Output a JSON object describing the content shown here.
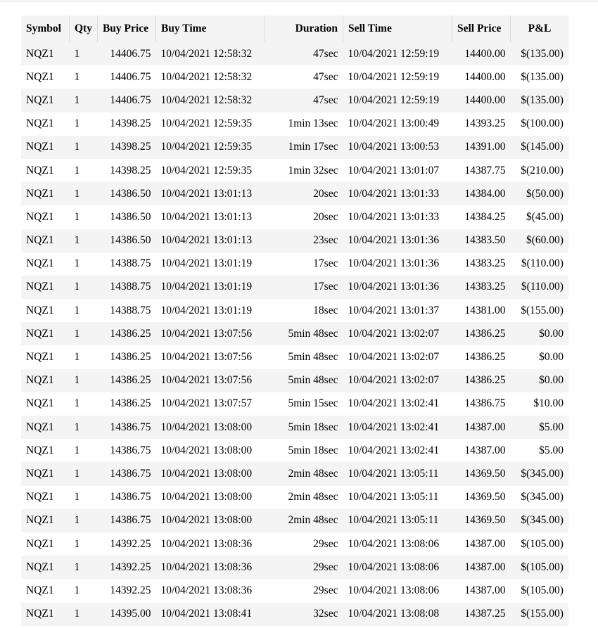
{
  "columns": {
    "symbol": "Symbol",
    "qty": "Qty",
    "buy_price": "Buy Price",
    "buy_time": "Buy Time",
    "duration": "Duration",
    "sell_time": "Sell Time",
    "sell_price": "Sell Price",
    "pnl": "P&L"
  },
  "rows": [
    {
      "symbol": "NQZ1",
      "qty": "1",
      "buy_price": "14406.75",
      "buy_time": "10/04/2021 12:58:32",
      "duration": "47sec",
      "sell_time": "10/04/2021 12:59:19",
      "sell_price": "14400.00",
      "pnl": "$(135.00)"
    },
    {
      "symbol": "NQZ1",
      "qty": "1",
      "buy_price": "14406.75",
      "buy_time": "10/04/2021 12:58:32",
      "duration": "47sec",
      "sell_time": "10/04/2021 12:59:19",
      "sell_price": "14400.00",
      "pnl": "$(135.00)"
    },
    {
      "symbol": "NQZ1",
      "qty": "1",
      "buy_price": "14406.75",
      "buy_time": "10/04/2021 12:58:32",
      "duration": "47sec",
      "sell_time": "10/04/2021 12:59:19",
      "sell_price": "14400.00",
      "pnl": "$(135.00)"
    },
    {
      "symbol": "NQZ1",
      "qty": "1",
      "buy_price": "14398.25",
      "buy_time": "10/04/2021 12:59:35",
      "duration": "1min 13sec",
      "sell_time": "10/04/2021 13:00:49",
      "sell_price": "14393.25",
      "pnl": "$(100.00)"
    },
    {
      "symbol": "NQZ1",
      "qty": "1",
      "buy_price": "14398.25",
      "buy_time": "10/04/2021 12:59:35",
      "duration": "1min 17sec",
      "sell_time": "10/04/2021 13:00:53",
      "sell_price": "14391.00",
      "pnl": "$(145.00)"
    },
    {
      "symbol": "NQZ1",
      "qty": "1",
      "buy_price": "14398.25",
      "buy_time": "10/04/2021 12:59:35",
      "duration": "1min 32sec",
      "sell_time": "10/04/2021 13:01:07",
      "sell_price": "14387.75",
      "pnl": "$(210.00)"
    },
    {
      "symbol": "NQZ1",
      "qty": "1",
      "buy_price": "14386.50",
      "buy_time": "10/04/2021 13:01:13",
      "duration": "20sec",
      "sell_time": "10/04/2021 13:01:33",
      "sell_price": "14384.00",
      "pnl": "$(50.00)"
    },
    {
      "symbol": "NQZ1",
      "qty": "1",
      "buy_price": "14386.50",
      "buy_time": "10/04/2021 13:01:13",
      "duration": "20sec",
      "sell_time": "10/04/2021 13:01:33",
      "sell_price": "14384.25",
      "pnl": "$(45.00)"
    },
    {
      "symbol": "NQZ1",
      "qty": "1",
      "buy_price": "14386.50",
      "buy_time": "10/04/2021 13:01:13",
      "duration": "23sec",
      "sell_time": "10/04/2021 13:01:36",
      "sell_price": "14383.50",
      "pnl": "$(60.00)"
    },
    {
      "symbol": "NQZ1",
      "qty": "1",
      "buy_price": "14388.75",
      "buy_time": "10/04/2021 13:01:19",
      "duration": "17sec",
      "sell_time": "10/04/2021 13:01:36",
      "sell_price": "14383.25",
      "pnl": "$(110.00)"
    },
    {
      "symbol": "NQZ1",
      "qty": "1",
      "buy_price": "14388.75",
      "buy_time": "10/04/2021 13:01:19",
      "duration": "17sec",
      "sell_time": "10/04/2021 13:01:36",
      "sell_price": "14383.25",
      "pnl": "$(110.00)"
    },
    {
      "symbol": "NQZ1",
      "qty": "1",
      "buy_price": "14388.75",
      "buy_time": "10/04/2021 13:01:19",
      "duration": "18sec",
      "sell_time": "10/04/2021 13:01:37",
      "sell_price": "14381.00",
      "pnl": "$(155.00)"
    },
    {
      "symbol": "NQZ1",
      "qty": "1",
      "buy_price": "14386.25",
      "buy_time": "10/04/2021 13:07:56",
      "duration": "5min 48sec",
      "sell_time": "10/04/2021 13:02:07",
      "sell_price": "14386.25",
      "pnl": "$0.00"
    },
    {
      "symbol": "NQZ1",
      "qty": "1",
      "buy_price": "14386.25",
      "buy_time": "10/04/2021 13:07:56",
      "duration": "5min 48sec",
      "sell_time": "10/04/2021 13:02:07",
      "sell_price": "14386.25",
      "pnl": "$0.00"
    },
    {
      "symbol": "NQZ1",
      "qty": "1",
      "buy_price": "14386.25",
      "buy_time": "10/04/2021 13:07:56",
      "duration": "5min 48sec",
      "sell_time": "10/04/2021 13:02:07",
      "sell_price": "14386.25",
      "pnl": "$0.00"
    },
    {
      "symbol": "NQZ1",
      "qty": "1",
      "buy_price": "14386.25",
      "buy_time": "10/04/2021 13:07:57",
      "duration": "5min 15sec",
      "sell_time": "10/04/2021 13:02:41",
      "sell_price": "14386.75",
      "pnl": "$10.00"
    },
    {
      "symbol": "NQZ1",
      "qty": "1",
      "buy_price": "14386.75",
      "buy_time": "10/04/2021 13:08:00",
      "duration": "5min 18sec",
      "sell_time": "10/04/2021 13:02:41",
      "sell_price": "14387.00",
      "pnl": "$5.00"
    },
    {
      "symbol": "NQZ1",
      "qty": "1",
      "buy_price": "14386.75",
      "buy_time": "10/04/2021 13:08:00",
      "duration": "5min 18sec",
      "sell_time": "10/04/2021 13:02:41",
      "sell_price": "14387.00",
      "pnl": "$5.00"
    },
    {
      "symbol": "NQZ1",
      "qty": "1",
      "buy_price": "14386.75",
      "buy_time": "10/04/2021 13:08:00",
      "duration": "2min 48sec",
      "sell_time": "10/04/2021 13:05:11",
      "sell_price": "14369.50",
      "pnl": "$(345.00)"
    },
    {
      "symbol": "NQZ1",
      "qty": "1",
      "buy_price": "14386.75",
      "buy_time": "10/04/2021 13:08:00",
      "duration": "2min 48sec",
      "sell_time": "10/04/2021 13:05:11",
      "sell_price": "14369.50",
      "pnl": "$(345.00)"
    },
    {
      "symbol": "NQZ1",
      "qty": "1",
      "buy_price": "14386.75",
      "buy_time": "10/04/2021 13:08:00",
      "duration": "2min 48sec",
      "sell_time": "10/04/2021 13:05:11",
      "sell_price": "14369.50",
      "pnl": "$(345.00)"
    },
    {
      "symbol": "NQZ1",
      "qty": "1",
      "buy_price": "14392.25",
      "buy_time": "10/04/2021 13:08:36",
      "duration": "29sec",
      "sell_time": "10/04/2021 13:08:06",
      "sell_price": "14387.00",
      "pnl": "$(105.00)"
    },
    {
      "symbol": "NQZ1",
      "qty": "1",
      "buy_price": "14392.25",
      "buy_time": "10/04/2021 13:08:36",
      "duration": "29sec",
      "sell_time": "10/04/2021 13:08:06",
      "sell_price": "14387.00",
      "pnl": "$(105.00)"
    },
    {
      "symbol": "NQZ1",
      "qty": "1",
      "buy_price": "14392.25",
      "buy_time": "10/04/2021 13:08:36",
      "duration": "29sec",
      "sell_time": "10/04/2021 13:08:06",
      "sell_price": "14387.00",
      "pnl": "$(105.00)"
    },
    {
      "symbol": "NQZ1",
      "qty": "1",
      "buy_price": "14395.00",
      "buy_time": "10/04/2021 13:08:41",
      "duration": "32sec",
      "sell_time": "10/04/2021 13:08:08",
      "sell_price": "14387.25",
      "pnl": "$(155.00)"
    }
  ]
}
